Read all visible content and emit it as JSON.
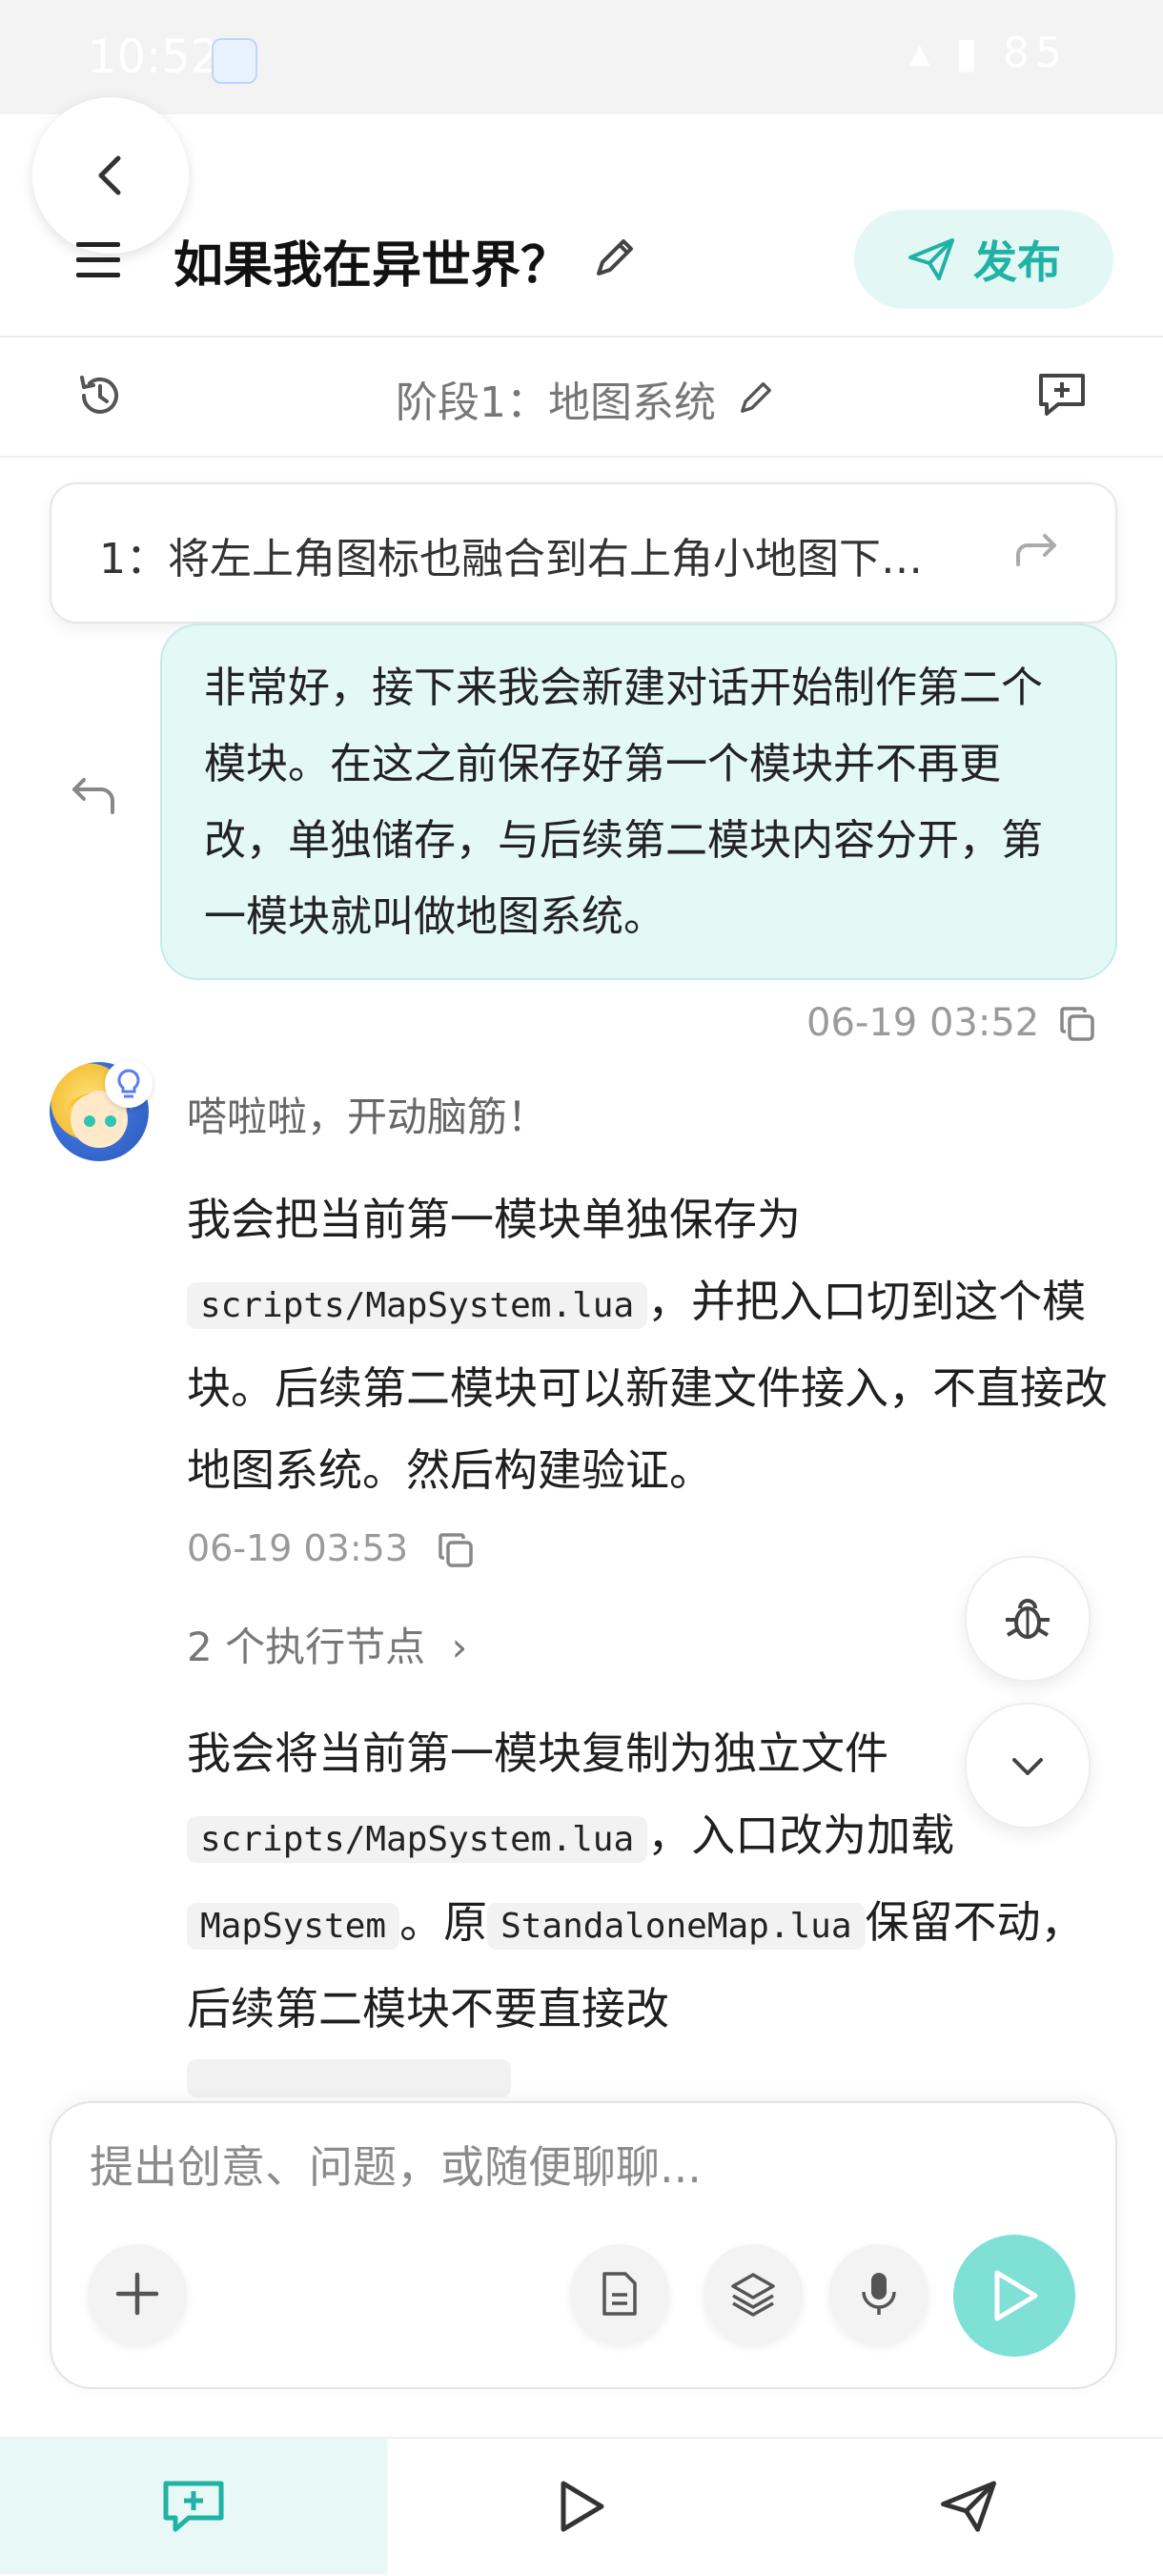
{
  "status_bar": {
    "time": "10:52",
    "battery": "85"
  },
  "header": {
    "title": "如果我在异世界？",
    "publish_label": "发布"
  },
  "stage": {
    "title": "阶段1：地图系统"
  },
  "queued_prompt": {
    "text": "1：将左上角图标也融合到右上角小地图下…"
  },
  "user_message": {
    "text": "非常好，接下来我会新建对话开始制作第二个模块。在这之前保存好第一个模块并不再更改，单独储存，与后续第二模块内容分开，第一模块就叫做地图系统。",
    "timestamp": "06-19 03:52"
  },
  "assistant": {
    "status": "嗒啦啦，开动脑筋！",
    "msg1": {
      "p1": "我会把当前第一模块单独保存为",
      "code1": "scripts/MapSystem.lua",
      "p2": "，并把入口切到这个模块。后续第二模块可以新建文件接入，不直接改地图系统。然后构建验证。"
    },
    "timestamp": "06-19 03:53",
    "exec_nodes": "2 个执行节点",
    "msg2": {
      "p1": "我会将当前第一模块复制为独立文件",
      "code1": "scripts/MapSystem.lua",
      "p2": "，入口改为加载",
      "code2": "MapSystem",
      "p3": "。原",
      "code3": "StandaloneMap.lua",
      "p4": "保留不动，后续第二模块不要直接改"
    }
  },
  "composer": {
    "placeholder": "提出创意、问题，或随便聊聊..."
  },
  "colors": {
    "accent": "#20b2a5",
    "bubble": "#e4f8f6",
    "send": "#7fe0d6"
  }
}
